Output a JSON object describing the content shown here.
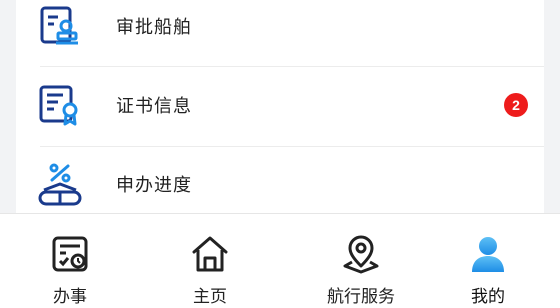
{
  "menu": {
    "items": [
      {
        "label": "审批船舶",
        "icon": "ship-approval-icon"
      },
      {
        "label": "证书信息",
        "icon": "certificate-icon",
        "badge": "2"
      },
      {
        "label": "申办进度",
        "icon": "progress-icon"
      }
    ]
  },
  "tabbar": {
    "items": [
      {
        "label": "办事",
        "icon": "tasks-icon"
      },
      {
        "label": "主页",
        "icon": "home-icon"
      },
      {
        "label": "航行服务",
        "icon": "location-pin-icon"
      },
      {
        "label": "我的",
        "icon": "user-profile-icon",
        "active": true
      }
    ]
  },
  "colors": {
    "icon_blue": "#1a3a8c",
    "accent_blue": "#1e8de6",
    "badge_red": "#ee1c1c"
  }
}
